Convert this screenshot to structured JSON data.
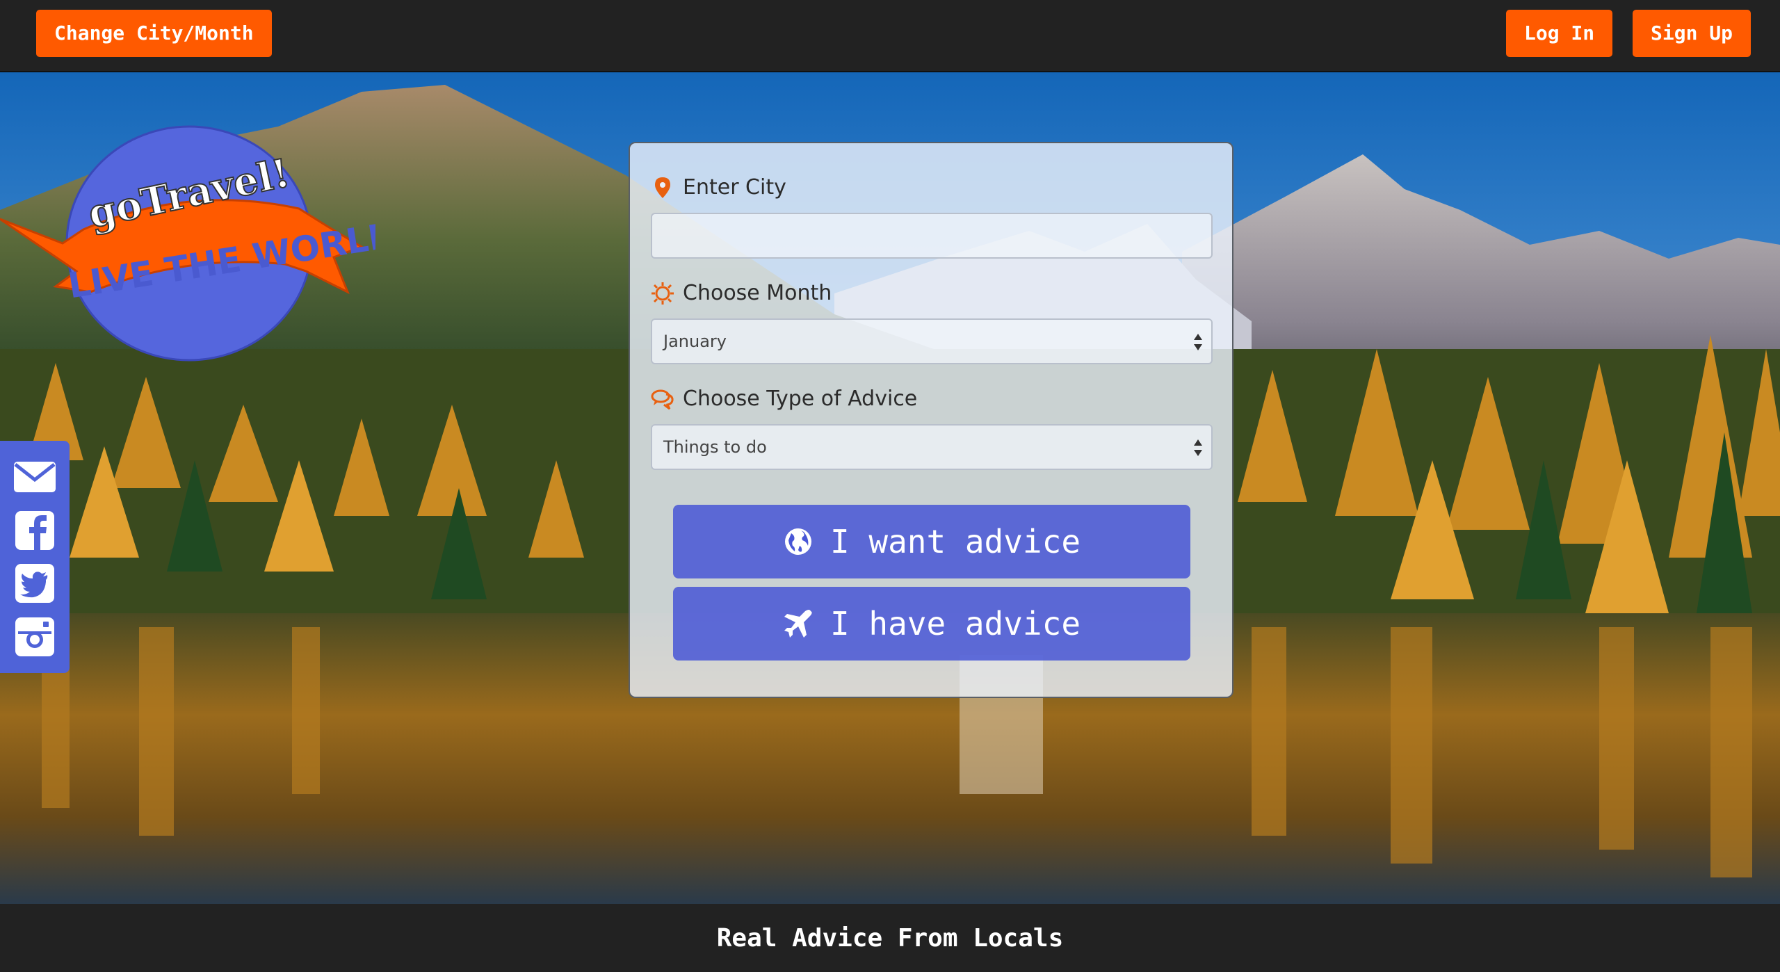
{
  "nav": {
    "change_label": "Change City/Month",
    "login_label": "Log In",
    "signup_label": "Sign Up"
  },
  "logo": {
    "line1": "goTravel!",
    "line2": "LIVE THE WORLD"
  },
  "social": {
    "items": [
      "envelope-icon",
      "facebook-icon",
      "twitter-icon",
      "instagram-icon"
    ]
  },
  "form": {
    "city_label": "Enter City",
    "city_value": "",
    "month_label": "Choose Month",
    "month_selected": "January",
    "type_label": "Choose Type of Advice",
    "type_selected": "Things to do",
    "want_label": "I want advice",
    "have_label": "I have advice"
  },
  "footer": {
    "tagline": "Real Advice From Locals"
  },
  "colors": {
    "accent_orange": "#ff5a00",
    "button_blue": "#4856d6",
    "bar_dark": "#222222",
    "logo_blue": "#5566dd"
  }
}
